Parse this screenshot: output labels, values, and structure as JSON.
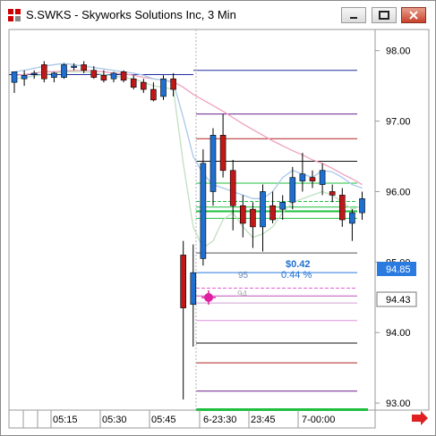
{
  "window": {
    "title": "S.SWKS - Skyworks Solutions Inc, 3 Min",
    "accent": "#cc0000"
  },
  "chart_data": {
    "type": "candlestick",
    "ylim": [
      92.9,
      98.3
    ],
    "yticks": [
      "98.00",
      "97.00",
      "96.00",
      "95.00",
      "94.00",
      "93.00"
    ],
    "ytick_values": [
      98.0,
      97.0,
      96.0,
      95.0,
      94.0,
      93.0
    ],
    "price_markers": [
      {
        "label": "94.85",
        "value": 94.85,
        "style": "blue"
      },
      {
        "label": "94.43",
        "value": 94.43,
        "style": "plain"
      }
    ],
    "time_labels": [
      "05:15",
      "05:30",
      "05:45",
      "6-23:30",
      "23:45",
      "7-00:00"
    ],
    "annotations": {
      "change_amount": "$0.42",
      "change_percent": "0.44 %",
      "line_label_95": "95",
      "line_label_94": "94"
    },
    "candles": [
      {
        "o": 97.55,
        "h": 97.7,
        "l": 97.4,
        "c": 97.7
      },
      {
        "o": 97.6,
        "h": 97.72,
        "l": 97.5,
        "c": 97.65
      },
      {
        "o": 97.68,
        "h": 97.72,
        "l": 97.6,
        "c": 97.68
      },
      {
        "o": 97.8,
        "h": 97.85,
        "l": 97.55,
        "c": 97.6
      },
      {
        "o": 97.62,
        "h": 97.7,
        "l": 97.55,
        "c": 97.68
      },
      {
        "o": 97.62,
        "h": 97.82,
        "l": 97.6,
        "c": 97.8
      },
      {
        "o": 97.78,
        "h": 97.82,
        "l": 97.72,
        "c": 97.78
      },
      {
        "o": 97.8,
        "h": 97.85,
        "l": 97.68,
        "c": 97.72
      },
      {
        "o": 97.72,
        "h": 97.78,
        "l": 97.6,
        "c": 97.62
      },
      {
        "o": 97.65,
        "h": 97.72,
        "l": 97.55,
        "c": 97.58
      },
      {
        "o": 97.6,
        "h": 97.7,
        "l": 97.55,
        "c": 97.68
      },
      {
        "o": 97.7,
        "h": 97.72,
        "l": 97.55,
        "c": 97.58
      },
      {
        "o": 97.6,
        "h": 97.65,
        "l": 97.45,
        "c": 97.48
      },
      {
        "o": 97.55,
        "h": 97.6,
        "l": 97.4,
        "c": 97.45
      },
      {
        "o": 97.45,
        "h": 97.55,
        "l": 97.28,
        "c": 97.3
      },
      {
        "o": 97.35,
        "h": 97.65,
        "l": 97.3,
        "c": 97.6
      },
      {
        "o": 97.6,
        "h": 97.68,
        "l": 97.35,
        "c": 97.45
      },
      {
        "o": 95.1,
        "h": 95.3,
        "l": 93.05,
        "c": 94.35
      },
      {
        "o": 94.4,
        "h": 95.25,
        "l": 93.8,
        "c": 94.85
      },
      {
        "o": 95.05,
        "h": 96.6,
        "l": 94.95,
        "c": 96.4
      },
      {
        "o": 96.0,
        "h": 96.9,
        "l": 95.8,
        "c": 96.8
      },
      {
        "o": 96.8,
        "h": 97.1,
        "l": 96.2,
        "c": 96.3
      },
      {
        "o": 96.3,
        "h": 96.45,
        "l": 95.45,
        "c": 95.8
      },
      {
        "o": 95.8,
        "h": 95.95,
        "l": 95.35,
        "c": 95.55
      },
      {
        "o": 95.75,
        "h": 95.85,
        "l": 95.2,
        "c": 95.5
      },
      {
        "o": 95.5,
        "h": 96.1,
        "l": 95.15,
        "c": 96.0
      },
      {
        "o": 95.8,
        "h": 96.0,
        "l": 95.55,
        "c": 95.6
      },
      {
        "o": 95.75,
        "h": 95.95,
        "l": 95.6,
        "c": 95.85
      },
      {
        "o": 95.85,
        "h": 96.35,
        "l": 95.75,
        "c": 96.2
      },
      {
        "o": 96.15,
        "h": 96.55,
        "l": 96.0,
        "c": 96.25
      },
      {
        "o": 96.2,
        "h": 96.3,
        "l": 96.05,
        "c": 96.15
      },
      {
        "o": 96.1,
        "h": 96.4,
        "l": 95.95,
        "c": 96.3
      },
      {
        "o": 96.0,
        "h": 96.1,
        "l": 95.85,
        "c": 95.95
      },
      {
        "o": 95.95,
        "h": 96.05,
        "l": 95.5,
        "c": 95.6
      },
      {
        "o": 95.55,
        "h": 95.75,
        "l": 95.3,
        "c": 95.7
      },
      {
        "o": 95.7,
        "h": 96.0,
        "l": 95.6,
        "c": 95.9
      }
    ],
    "horizontal_levels": [
      {
        "value": 97.72,
        "color": "#1f2fa0"
      },
      {
        "value": 97.1,
        "color": "#6a1f8c"
      },
      {
        "value": 96.75,
        "color": "#b02020"
      },
      {
        "value": 96.43,
        "color": "#111111"
      },
      {
        "value": 96.12,
        "color": "#1fbf3f"
      },
      {
        "value": 95.86,
        "color": "#1fbf3f",
        "dashed": true
      },
      {
        "value": 95.78,
        "color": "#1fbf3f"
      },
      {
        "value": 95.72,
        "color": "#1fbf3f",
        "bold": true
      },
      {
        "value": 95.62,
        "color": "#1fbf3f"
      },
      {
        "value": 95.13,
        "color": "#555555"
      },
      {
        "value": 94.85,
        "color": "#2a7ae0"
      },
      {
        "value": 94.63,
        "color": "#e060d0",
        "dashed": true
      },
      {
        "value": 94.52,
        "color": "#c050c0"
      },
      {
        "value": 94.42,
        "color": "#d0a0d0"
      },
      {
        "value": 94.17,
        "color": "#e090e0"
      },
      {
        "value": 93.85,
        "color": "#111111"
      },
      {
        "value": 93.57,
        "color": "#b02020"
      },
      {
        "value": 93.17,
        "color": "#6a1f8c"
      }
    ],
    "line_series": [
      {
        "color": "#f0a0c0",
        "values": [
          97.65,
          97.66,
          97.68,
          97.7,
          97.7,
          97.71,
          97.72,
          97.72,
          97.71,
          97.7,
          97.68,
          97.67,
          97.65,
          97.62,
          97.6,
          97.58,
          97.56,
          97.48,
          97.38,
          97.3,
          97.22,
          97.14,
          97.05,
          96.96,
          96.88,
          96.8,
          96.72,
          96.65,
          96.58,
          96.52,
          96.45,
          96.4,
          96.33,
          96.25,
          96.18,
          96.1
        ]
      },
      {
        "color": "#a8c8e8",
        "values": [
          97.7,
          97.72,
          97.75,
          97.78,
          97.8,
          97.82,
          97.8,
          97.78,
          97.76,
          97.74,
          97.72,
          97.7,
          97.68,
          97.65,
          97.6,
          97.58,
          97.55,
          97.05,
          96.5,
          96.25,
          96.1,
          96.05,
          96.0,
          95.95,
          95.9,
          95.9,
          96.0,
          96.2,
          96.3,
          96.25,
          96.2,
          96.3,
          96.28,
          96.2,
          96.1,
          96.05
        ]
      },
      {
        "color": "#c0e0c0",
        "values": [
          97.6,
          97.62,
          97.64,
          97.66,
          97.68,
          97.7,
          97.7,
          97.7,
          97.68,
          97.66,
          97.64,
          97.62,
          97.6,
          97.55,
          97.5,
          97.48,
          97.45,
          96.4,
          95.5,
          95.2,
          95.3,
          95.6,
          95.7,
          95.5,
          95.35,
          95.4,
          95.5,
          95.7,
          95.85,
          95.9,
          95.95,
          96.0,
          95.95,
          95.85,
          95.75,
          95.8
        ]
      }
    ]
  }
}
